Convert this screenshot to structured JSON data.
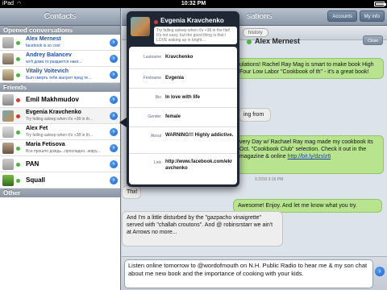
{
  "status": {
    "carrier": "iPad",
    "time": "10:32 PM"
  },
  "left": {
    "title": "Contacts",
    "sections": {
      "opened": "Opened conversations",
      "friends": "Friends",
      "other": "Other"
    },
    "opened": [
      {
        "name": "Alex Mernest",
        "status": "facebook is so cool",
        "dot": "#4db33d"
      },
      {
        "name": "Andrey Balancev",
        "status": "wi-fi дома то раздается нако...",
        "dot": "#4db33d"
      },
      {
        "name": "Vitaliy Voitevich",
        "status": "Был смерть тебе жалуют пред те...",
        "dot": "#4db33d"
      }
    ],
    "friends": [
      {
        "name": "Emil Makhmudov",
        "status": "",
        "dot": "#d13a2e"
      },
      {
        "name": "Evgenia Kravchenko",
        "status": "Try falling asleep when it's +38 in th...",
        "dot": "#d13a2e"
      },
      {
        "name": "Alex Fet",
        "status": "Try falling asleep when it's +38 in th...",
        "dot": "#4db33d"
      },
      {
        "name": "Maria Fetisova",
        "status": "Все прошло дождь...прохладно...жару...",
        "dot": "#4db33d"
      },
      {
        "name": "PAN",
        "status": "",
        "dot": "#4db33d"
      },
      {
        "name": "Squall",
        "status": "",
        "dot": "#4db33d"
      }
    ]
  },
  "chat": {
    "title_fragment": "sations",
    "accounts_label": "Accounts",
    "myinfo_label": "My info",
    "history_label": "history",
    "contact_name": "Alex Mernest",
    "close_label": "Close",
    "messages": [
      {
        "id": "m1",
        "text": "ulations! Rachel Ray Mag is smart to make book High Four Low Labor \"Cookbook of th\" - it's a great book!"
      },
      {
        "id": "m2",
        "text": "ing from"
      },
      {
        "id": "m3",
        "text": "very Day w/ Rachael Ray mag made my cookbook its Oct. \"Cookbook Club\" selection. Check it out in the magazine & online",
        "link": "http://bit.ly/dzslz6"
      },
      {
        "id": "m4",
        "text": "Thx!"
      },
      {
        "id": "m5",
        "text": "Awesome! Enjoy. And let me know what you try."
      },
      {
        "id": "m6",
        "text": "And I'm a little disturbed by the \"gazpacho vinaigrette\" served with \"challah croutons\". And @ robinsrstarr we ain't at Arrows no more..."
      }
    ],
    "timestamp": "9.2010 3:16 PM",
    "composer_text": "Listen online tomorrow to @wordofmouth on N.H. Public Radio to hear me & my son chat about me new book and the importance of cooking with your kids."
  },
  "popover": {
    "name": "Evgenia Kravchenko",
    "status": "Try falling asleep when it's +38 in the flat! It's not easy, but the good thing is that I LOVE waking up in bright...",
    "fields": [
      {
        "key": "Lastname",
        "value": "Kravchenko"
      },
      {
        "key": "Firstname",
        "value": "Evgenia"
      },
      {
        "key": "Bio",
        "value": "In love with life"
      },
      {
        "key": "Gender",
        "value": "female"
      },
      {
        "key": "About",
        "value": "WARNING!!! Highly addictive."
      },
      {
        "key": "Link",
        "value": "http://www.facebook.com/ekravchenko"
      }
    ]
  }
}
